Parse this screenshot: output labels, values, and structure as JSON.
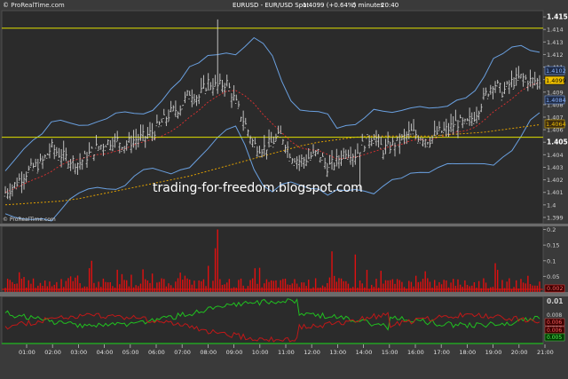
{
  "header": {
    "site": "© ProRealTime.com",
    "instrument": "EURUSD - EUR/USD Spot",
    "last": "1.4099 (+0.64%)",
    "timeframe": "5 minutes",
    "time": "20:40"
  },
  "watermark": "trading-for-freedom.blogspot.com",
  "footer_site": "© ProRealTime.com",
  "colors": {
    "background": "#3a3a3a",
    "panel": "#2a2a2a",
    "bar": "#cfcfcf",
    "bollinger": "#6aa0e0",
    "ma_short": "#e03030",
    "ma_long": "#e0a000",
    "hline": "#e0e000",
    "volume": "#e01010",
    "di_plus": "#20c020",
    "di_minus": "#c01818"
  },
  "chart_data": [
    {
      "type": "line",
      "panel": "price",
      "yaxis_ticks": [
        "1.415",
        "1.414",
        "1.413",
        "1.412",
        "1.411",
        "1.41",
        "1.409",
        "1.408",
        "1.407",
        "1.406",
        "1.405",
        "1.404",
        "1.403",
        "1.402",
        "1.401",
        "1.4",
        "1.399"
      ],
      "ylim": [
        1.3985,
        1.4155
      ],
      "xaxis_ticks": [
        "01:00",
        "02:00",
        "03:00",
        "04:00",
        "05:00",
        "06:00",
        "07:00",
        "08:00",
        "09:00",
        "10:00",
        "11:00",
        "12:00",
        "13:00",
        "14:00",
        "15:00",
        "16:00",
        "17:00",
        "18:00",
        "19:00",
        "20:00",
        "21:00"
      ],
      "horizontal_lines": [
        1.4141,
        1.4054
      ],
      "value_labels": [
        {
          "text": "1.4102",
          "kind": "upper_band"
        },
        {
          "text": "1.4099",
          "kind": "last"
        },
        {
          "text": "1.4084",
          "kind": "lower_band"
        },
        {
          "text": "1.4064",
          "kind": "ma"
        }
      ],
      "close": [
        1.401,
        1.4016,
        1.4024,
        1.403,
        1.4034,
        1.4046,
        1.404,
        1.4036,
        1.4033,
        1.404,
        1.4046,
        1.405,
        1.4052,
        1.4048,
        1.4052,
        1.4054,
        1.4058,
        1.4066,
        1.4074,
        1.4078,
        1.409,
        1.4086,
        1.4098,
        1.4094,
        1.4098,
        1.4082,
        1.4065,
        1.4048,
        1.4045,
        1.405,
        1.4056,
        1.404,
        1.4035,
        1.4038,
        1.4042,
        1.403,
        1.4035,
        1.4044,
        1.404,
        1.405,
        1.4056,
        1.4044,
        1.4048,
        1.4052,
        1.4058,
        1.4055,
        1.4052,
        1.4058,
        1.406,
        1.4066,
        1.4064,
        1.4072,
        1.4086,
        1.4098,
        1.409,
        1.4098,
        1.4102,
        1.4099,
        1.4099
      ],
      "ma_long": [
        1.4,
        1.4001,
        1.4002,
        1.4003,
        1.4005,
        1.4008,
        1.4011,
        1.4014,
        1.4017,
        1.402,
        1.4023,
        1.4027,
        1.4031,
        1.4035,
        1.4039,
        1.4043,
        1.4047,
        1.405,
        1.4052,
        1.4054,
        1.4055,
        1.4055,
        1.4055,
        1.4055,
        1.4056,
        1.4057,
        1.4058,
        1.406,
        1.4062,
        1.4064
      ]
    },
    {
      "type": "bar",
      "panel": "volume",
      "yaxis_ticks": [
        "0.2",
        "0.15",
        "0.1",
        "0.05"
      ],
      "ylim": [
        0,
        0.21
      ],
      "value_label": "0.002"
    },
    {
      "type": "line",
      "panel": "directional",
      "yaxis_ticks": [
        "0.01",
        "0.008",
        "0.006",
        "0.004",
        "0.002"
      ],
      "value_labels": [
        "0.006",
        "0.006",
        "0.005",
        "0.003",
        "0.002"
      ],
      "series": [
        {
          "name": "",
          "color": "green"
        },
        {
          "name": "",
          "color": "red"
        }
      ]
    }
  ]
}
